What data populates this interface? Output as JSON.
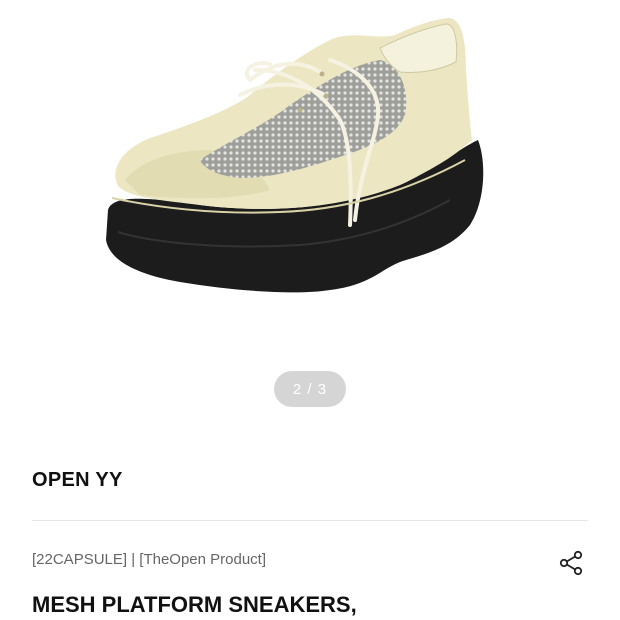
{
  "gallery": {
    "image_subject": "sneaker-photo",
    "pager_text": "2 / 3"
  },
  "product": {
    "brand": "OPEN YY",
    "tags": "[22CAPSULE] | [TheOpen Product]",
    "title": "MESH PLATFORM SNEAKERS,"
  },
  "icons": {
    "share": "share-icon"
  },
  "colors": {
    "pager_bg": "#d5d5d5",
    "text_primary": "#111111",
    "text_secondary": "#666666",
    "divider": "#e6e6e6"
  }
}
